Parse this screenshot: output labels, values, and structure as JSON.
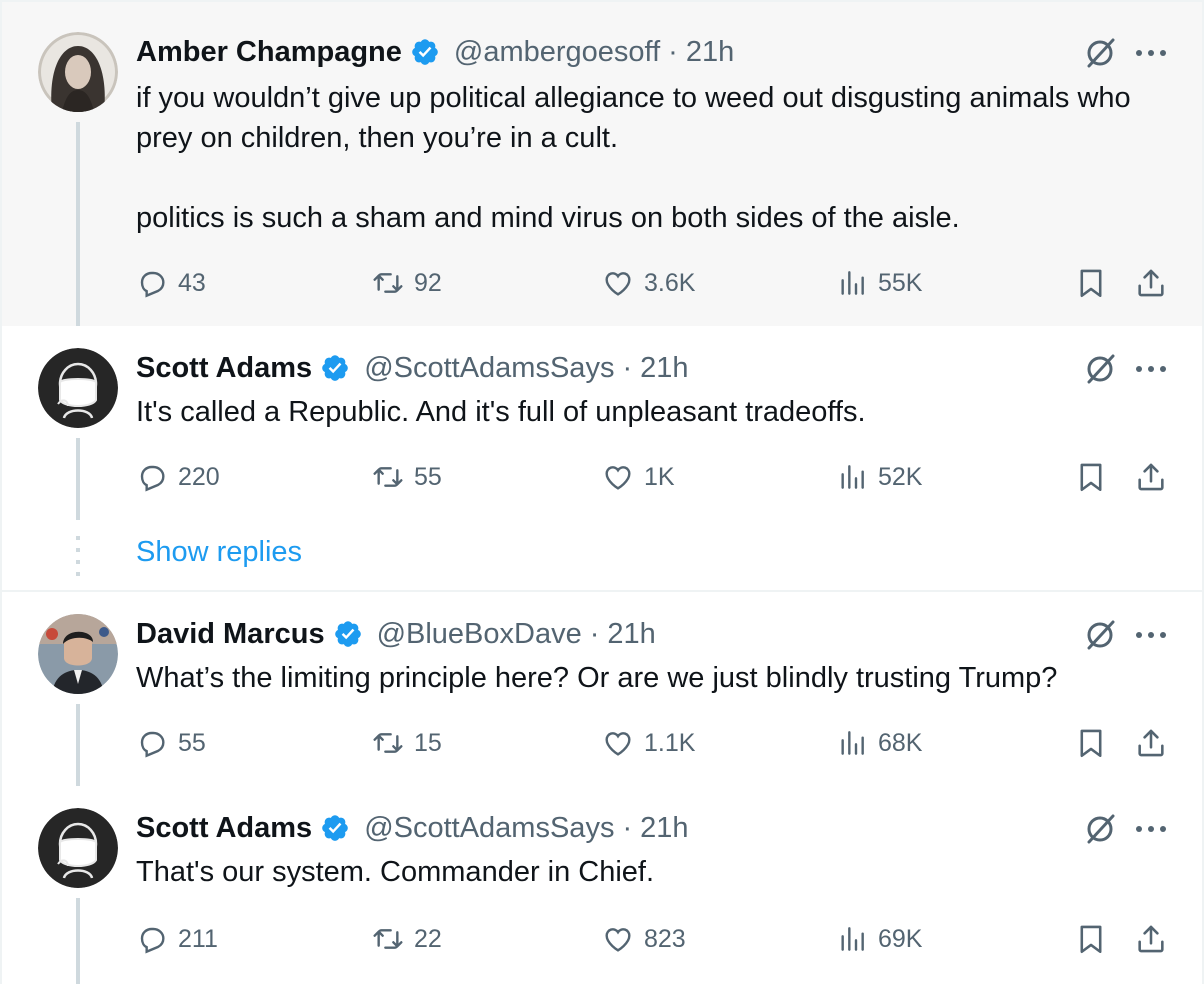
{
  "colors": {
    "accent": "#1d9bf0",
    "muted": "#536471",
    "text": "#0f1419",
    "highlight_bg": "#f7f7f7"
  },
  "tweets": [
    {
      "name": "Amber Champagne",
      "handle": "@ambergoesoff",
      "time": "21h",
      "verified": true,
      "text": "if you wouldn’t give up political allegiance to weed out disgusting animals who prey on children, then you’re in a cult.\n\npolitics is such a sham and mind virus on both sides of the aisle.",
      "replies": "43",
      "reposts": "92",
      "likes": "3.6K",
      "views": "55K",
      "avatar": "woman-photo"
    },
    {
      "name": "Scott Adams",
      "handle": "@ScottAdamsSays",
      "time": "21h",
      "verified": true,
      "text": "It's called a Republic. And it's full of unpleasant tradeoffs.",
      "replies": "220",
      "reposts": "55",
      "likes": "1K",
      "views": "52K",
      "avatar": "cartoon-face-mask"
    },
    {
      "name": "David Marcus",
      "handle": "@BlueBoxDave",
      "time": "21h",
      "verified": true,
      "text": "What’s the limiting principle here? Or are we just blindly trusting Trump?",
      "replies": "55",
      "reposts": "15",
      "likes": "1.1K",
      "views": "68K",
      "avatar": "man-photo"
    },
    {
      "name": "Scott Adams",
      "handle": "@ScottAdamsSays",
      "time": "21h",
      "verified": true,
      "text": "That's our system. Commander in Chief.",
      "replies": "211",
      "reposts": "22",
      "likes": "823",
      "views": "69K",
      "avatar": "cartoon-face-mask"
    }
  ],
  "show_replies_label": "Show replies",
  "icons": {
    "reply": "reply-icon",
    "repost": "repost-icon",
    "like": "heart-icon",
    "views": "views-icon",
    "bookmark": "bookmark-icon",
    "share": "share-icon",
    "grok": "grok-icon",
    "more": "more-icon",
    "verified": "verified-badge-icon"
  }
}
